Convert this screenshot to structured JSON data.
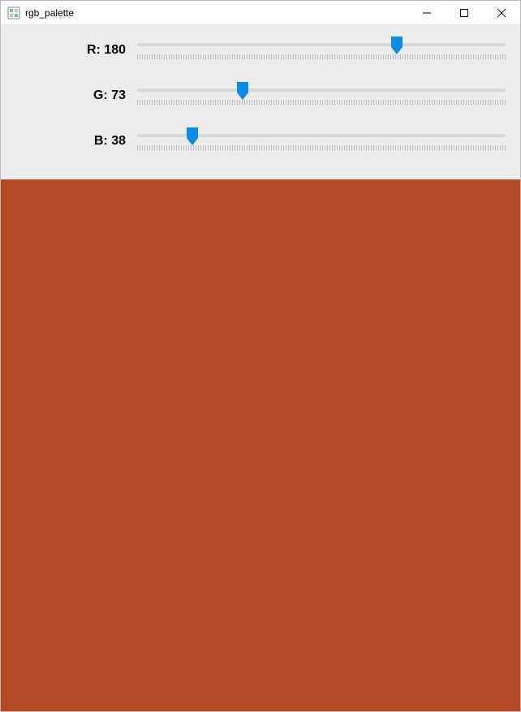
{
  "window": {
    "title": "rgb_palette"
  },
  "sliders": {
    "min": 0,
    "max": 255,
    "r": {
      "label": "R: 180",
      "value": 180
    },
    "g": {
      "label": "G: 73",
      "value": 73
    },
    "b": {
      "label": "B: 38",
      "value": 38
    }
  },
  "preview_color": "#b44926",
  "thumb_color": "#0c8ce9"
}
